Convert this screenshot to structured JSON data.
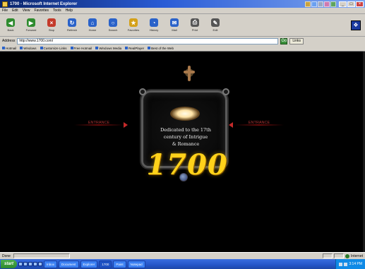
{
  "window": {
    "title": "1700 - Microsoft Internet Explorer",
    "controls": [
      "_",
      "□",
      "×"
    ]
  },
  "menubar": {
    "items": [
      "File",
      "Edit",
      "View",
      "Favorites",
      "Tools",
      "Help"
    ]
  },
  "toolbar": {
    "buttons": [
      {
        "label": "Back",
        "icon": "back-arrow-icon",
        "color": "#2e8b2e"
      },
      {
        "label": "Forward",
        "icon": "forward-arrow-icon",
        "color": "#2e8b2e"
      },
      {
        "label": "Stop",
        "icon": "stop-icon",
        "color": "#c43a2a"
      },
      {
        "label": "Refresh",
        "icon": "refresh-icon",
        "color": "#2a62c9"
      },
      {
        "label": "Home",
        "icon": "home-icon",
        "color": "#2a62c9"
      },
      {
        "label": "Search",
        "icon": "search-icon",
        "color": "#2a62c9"
      },
      {
        "label": "Favorites",
        "icon": "favorites-icon",
        "color": "#d4a017"
      },
      {
        "label": "History",
        "icon": "history-icon",
        "color": "#2a62c9"
      },
      {
        "label": "Mail",
        "icon": "mail-icon",
        "color": "#2a62c9"
      },
      {
        "label": "Print",
        "icon": "print-icon",
        "color": "#555555"
      },
      {
        "label": "Edit",
        "icon": "edit-icon",
        "color": "#555555"
      }
    ]
  },
  "address": {
    "label": "Address",
    "value": "http://www.1700.com/",
    "go_label": "Go",
    "links_label": "Links"
  },
  "links_bar": {
    "items": [
      "Hotmail",
      "Windows",
      "Customize Links",
      "Free Hotmail",
      "Windows Media",
      "RealPlayer",
      "Best of the Web"
    ]
  },
  "page": {
    "nav_left": "ENTRANCE",
    "nav_right": "ENTRANCE",
    "frame_lines": [
      "Dedicated to the 17th",
      "century of Intrigue",
      "& Romance"
    ],
    "year": "1700"
  },
  "statusbar": {
    "text": "Done",
    "zone": "Internet"
  },
  "taskbar": {
    "start_label": "start",
    "tasks": [
      "Inbox",
      "Document",
      "Explorer",
      "1700",
      "Paint",
      "Notepad"
    ],
    "clock": "3:14 PM"
  },
  "colors": {
    "page_background": "#000000",
    "year_gold": "#ffd21a",
    "nav_red": "#c42a2a"
  }
}
